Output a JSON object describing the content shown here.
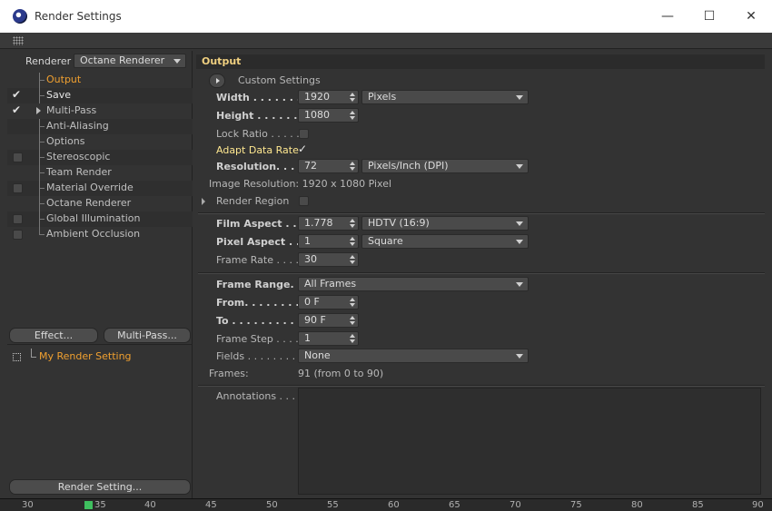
{
  "window": {
    "title": "Render Settings",
    "controls": {
      "minimize": "—",
      "maximize": "☐",
      "close": "✕"
    }
  },
  "left": {
    "renderer_label": "Renderer",
    "renderer_value": "Octane Renderer",
    "items": [
      {
        "label": "Output",
        "checkbox": "none",
        "active": true
      },
      {
        "label": "Save",
        "checkbox": "checked"
      },
      {
        "label": "Multi-Pass",
        "checkbox": "checked",
        "arrow": true
      },
      {
        "label": "Anti-Aliasing",
        "checkbox": "none"
      },
      {
        "label": "Options",
        "checkbox": "none"
      },
      {
        "label": "Stereoscopic",
        "checkbox": "unchecked"
      },
      {
        "label": "Team Render",
        "checkbox": "none"
      },
      {
        "label": "Material Override",
        "checkbox": "unchecked"
      },
      {
        "label": "Octane Renderer",
        "checkbox": "none"
      },
      {
        "label": "Global Illumination",
        "checkbox": "unchecked"
      },
      {
        "label": "Ambient Occlusion",
        "checkbox": "unchecked"
      }
    ],
    "effect_button": "Effect...",
    "multipass_button": "Multi-Pass...",
    "setting_name": "My Render Setting",
    "render_setting_button": "Render Setting..."
  },
  "right": {
    "section_title": "Output",
    "custom_settings": "Custom Settings",
    "width_label": "Width . . . . . . . . .",
    "width_value": "1920",
    "width_unit": "Pixels",
    "height_label": "Height . . . . . . . .",
    "height_value": "1080",
    "lock_ratio_label": "Lock Ratio . . . . .",
    "adapt_label": "Adapt Data Rate",
    "adapt_check": "✓",
    "resolution_label": "Resolution. . . . .",
    "resolution_value": "72",
    "resolution_unit": "Pixels/Inch (DPI)",
    "image_resolution": "Image Resolution: 1920 x 1080 Pixel",
    "render_region_label": "Render Region",
    "film_aspect_label": "Film Aspect . . . .",
    "film_aspect_value": "1.778",
    "film_aspect_preset": "HDTV (16:9)",
    "pixel_aspect_label": "Pixel Aspect . . .",
    "pixel_aspect_value": "1",
    "pixel_aspect_preset": "Square",
    "frame_rate_label": "Frame Rate . . . .",
    "frame_rate_value": "30",
    "frame_range_label": "Frame Range. . .",
    "frame_range_value": "All Frames",
    "from_label": "From. . . . . . . . . .",
    "from_value": "0 F",
    "to_label": "To . . . . . . . . . . . .",
    "to_value": "90 F",
    "frame_step_label": "Frame Step . . . .",
    "frame_step_value": "1",
    "fields_label": "Fields . . . . . . . . .",
    "fields_value": "None",
    "frames_label": "Frames:",
    "frames_value": "91 (from 0 to 90)",
    "annotations_label": "Annotations . . . ."
  },
  "timeline": {
    "ticks": [
      "30",
      "35",
      "40",
      "45",
      "50",
      "55",
      "60",
      "65",
      "70",
      "75",
      "80",
      "85",
      "90"
    ]
  },
  "icons": {
    "app": "cinema4d-logo-icon",
    "grip": "grip-icon"
  }
}
